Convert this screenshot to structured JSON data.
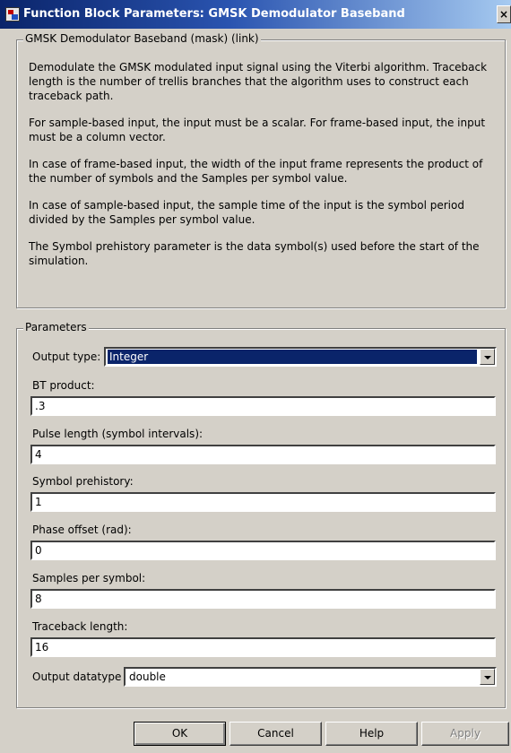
{
  "window": {
    "title": "Function Block Parameters: GMSK Demodulator Baseband",
    "close_glyph": "×"
  },
  "description_group": {
    "legend": "GMSK Demodulator Baseband (mask) (link)",
    "paragraphs": [
      "Demodulate the GMSK modulated input signal using the Viterbi algorithm. Traceback length is the number of trellis branches that the algorithm uses to construct each traceback path.",
      "For sample-based input, the input must be a scalar. For frame-based input, the input must be a column vector.",
      "In case of frame-based input, the width of the input frame represents the product of the number of symbols and the Samples per symbol value.",
      "In case of sample-based input, the sample time of the input is the symbol period divided by the Samples per symbol value.",
      "The Symbol prehistory parameter is the data symbol(s) used before the start of the simulation."
    ]
  },
  "parameters_group": {
    "legend": "Parameters",
    "output_type": {
      "label": "Output type:",
      "value": "Integer"
    },
    "bt_product": {
      "label": "BT product:",
      "value": ".3"
    },
    "pulse_length": {
      "label": "Pulse length (symbol intervals):",
      "value": "4"
    },
    "symbol_prehistory": {
      "label": "Symbol prehistory:",
      "value": "1"
    },
    "phase_offset": {
      "label": "Phase offset (rad):",
      "value": "0"
    },
    "samples_per_symbol": {
      "label": "Samples per symbol:",
      "value": "8"
    },
    "traceback_length": {
      "label": "Traceback length:",
      "value": "16"
    },
    "output_datatype": {
      "label": "Output datatype",
      "value": "double"
    }
  },
  "buttons": {
    "ok": "OK",
    "cancel": "Cancel",
    "help": "Help",
    "apply": "Apply"
  },
  "colors": {
    "title_bar_start": "#0a246a",
    "title_bar_end": "#a6caf0",
    "dialog_face": "#d4d0c8",
    "selection": "#0a246a"
  }
}
